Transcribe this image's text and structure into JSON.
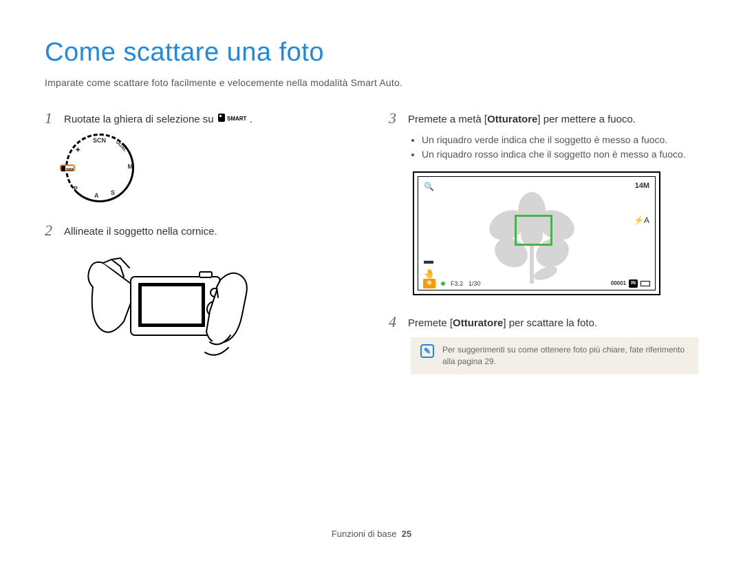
{
  "title": "Come scattare una foto",
  "subtitle": "Imparate come scattare foto facilmente e velocemente nella modalità Smart Auto.",
  "steps": {
    "s1": {
      "num": "1",
      "text_before": "Ruotate la ghiera di selezione su ",
      "icon_label": "SMART",
      "text_after": "."
    },
    "s2": {
      "num": "2",
      "text": "Allineate il soggetto nella cornice."
    },
    "s3": {
      "num": "3",
      "text_before": "Premete a metà [",
      "bold": "Otturatore",
      "text_after": "] per mettere a fuoco."
    },
    "s4": {
      "num": "4",
      "text_before": "Premete [",
      "bold": "Otturatore",
      "text_after": "] per scattare la foto."
    }
  },
  "bullets": {
    "b1": "Un riquadro verde indica che il soggetto è messo a fuoco.",
    "b2": "Un riquadro rosso indica che il soggetto non è messo a fuoco."
  },
  "dial": {
    "scn": "SCN",
    "dual": "DUAL",
    "m": "M",
    "s": "S",
    "a": "A",
    "p": "P",
    "smart": "SMART"
  },
  "display": {
    "top_left_icon": "🔍",
    "resolution": "14M",
    "flash_icon": "⚡A",
    "stabilization_icon": "🤚",
    "macro_icon": "❀",
    "aperture": "F3.2",
    "shutter": "1/30",
    "counter": "00001",
    "storage": "IN",
    "battery_icon": "batt"
  },
  "note": {
    "icon": "✎",
    "text": "Per suggerimenti su come ottenere foto più chiare, fate riferimento alla pagina 29."
  },
  "footer": {
    "section": "Funzioni di base",
    "page": "25"
  }
}
